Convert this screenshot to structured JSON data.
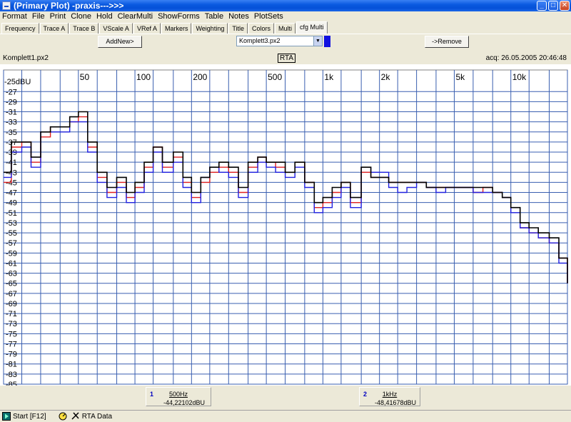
{
  "window": {
    "title": "(Primary Plot) -praxis--->>>",
    "min": "_",
    "max": "□",
    "close": "✕"
  },
  "menu": [
    "Format",
    "File",
    "Print",
    "Clone",
    "Hold",
    "ClearMulti",
    "ShowForms",
    "Table",
    "Notes",
    "PlotSets"
  ],
  "tabs": [
    "Frequency",
    "Trace A",
    "Trace B",
    "VScale A",
    "VRef A",
    "Markers",
    "Weighting",
    "Title",
    "Colors",
    "Multi",
    "cfg Multi"
  ],
  "active_tab": 10,
  "controls": {
    "add_label": "AddNew>",
    "remove_label": "->Remove",
    "selected_file": "Komplett3.px2",
    "swatch_color": "#1010e0"
  },
  "plot_info": {
    "file": "Komplett1.px2",
    "mode": "RTA",
    "acq": "acq: 26.05.2005 20:46:48"
  },
  "chart_data": {
    "type": "line",
    "x_scale": "log",
    "xlim": [
      20,
      20000
    ],
    "ylim": [
      -85,
      -23
    ],
    "y_unit_label": "-25dBU",
    "y_ticks": [
      -27,
      -29,
      -31,
      -33,
      -35,
      -37,
      -39,
      -41,
      -43,
      -45,
      -47,
      -49,
      -51,
      -53,
      -55,
      -57,
      -59,
      -61,
      -63,
      -65,
      -67,
      -69,
      -71,
      -73,
      -75,
      -77,
      -79,
      -81,
      -83,
      -85
    ],
    "x_labels": [
      {
        "f": 50,
        "label": "50"
      },
      {
        "f": 100,
        "label": "100"
      },
      {
        "f": 200,
        "label": "200"
      },
      {
        "f": 500,
        "label": "500"
      },
      {
        "f": 1000,
        "label": "1k"
      },
      {
        "f": 2000,
        "label": "2k"
      },
      {
        "f": 5000,
        "label": "5k"
      },
      {
        "f": 10000,
        "label": "10k"
      }
    ],
    "x_grid": [
      20,
      25,
      31.5,
      40,
      50,
      63,
      80,
      100,
      125,
      160,
      200,
      250,
      315,
      400,
      500,
      630,
      800,
      1000,
      1250,
      1600,
      2000,
      2500,
      3150,
      4000,
      5000,
      6300,
      8000,
      10000,
      12500,
      16000,
      20000
    ],
    "grid": true,
    "series": [
      {
        "color": "#e02020",
        "x": [
          20,
          22,
          25,
          28,
          31.5,
          35.5,
          40,
          45,
          50,
          56,
          63,
          71,
          80,
          90,
          100,
          112,
          125,
          140,
          160,
          180,
          200,
          224,
          250,
          280,
          315,
          355,
          400,
          450,
          500,
          560,
          630,
          710,
          800,
          900,
          1000,
          1120,
          1250,
          1400,
          1600,
          1800,
          2000,
          2240,
          2500,
          2800,
          3150,
          3550,
          4000,
          4500,
          5000,
          5600,
          6300,
          7100,
          8000,
          9000,
          10000,
          11200,
          12500,
          14000,
          16000,
          18000,
          20000
        ],
        "y": [
          -45,
          -38,
          -37,
          -41,
          -36,
          -34,
          -34,
          -33,
          -32,
          -38,
          -44,
          -47,
          -45,
          -48,
          -46,
          -42,
          -38,
          -42,
          -40,
          -45,
          -48,
          -45,
          -43,
          -42,
          -43,
          -47,
          -42,
          -40,
          -41,
          -42,
          -43,
          -41,
          -45,
          -50,
          -49,
          -47,
          -45,
          -49,
          -43,
          -44,
          -44,
          -45,
          -45,
          -45,
          -45,
          -46,
          -46,
          -46,
          -46,
          -46,
          -47,
          -46,
          -47,
          -48,
          -50,
          -54,
          -55,
          -56,
          -57,
          -60,
          -65
        ]
      },
      {
        "color": "#2020e0",
        "x": [
          20,
          22,
          25,
          28,
          31.5,
          35.5,
          40,
          45,
          50,
          56,
          63,
          71,
          80,
          90,
          100,
          112,
          125,
          140,
          160,
          180,
          200,
          224,
          250,
          280,
          315,
          355,
          400,
          450,
          500,
          560,
          630,
          710,
          800,
          900,
          1000,
          1120,
          1250,
          1400,
          1600,
          1800,
          2000,
          2240,
          2500,
          2800,
          3150,
          3550,
          4000,
          4500,
          5000,
          5600,
          6300,
          7100,
          8000,
          9000,
          10000,
          11200,
          12500,
          14000,
          16000,
          18000,
          20000
        ],
        "y": [
          -44,
          -39,
          -38,
          -42,
          -35,
          -35,
          -35,
          -33,
          -33,
          -39,
          -45,
          -48,
          -46,
          -49,
          -47,
          -43,
          -39,
          -43,
          -41,
          -46,
          -49,
          -44,
          -42,
          -43,
          -44,
          -48,
          -43,
          -41,
          -42,
          -43,
          -44,
          -42,
          -46,
          -51,
          -50,
          -48,
          -46,
          -50,
          -42,
          -43,
          -43,
          -46,
          -47,
          -46,
          -45,
          -46,
          -47,
          -46,
          -46,
          -46,
          -47,
          -47,
          -47,
          -48,
          -51,
          -54,
          -55,
          -56,
          -57,
          -61,
          -65
        ]
      },
      {
        "color": "#000000",
        "x": [
          20,
          22,
          25,
          28,
          31.5,
          35.5,
          40,
          45,
          50,
          56,
          63,
          71,
          80,
          90,
          100,
          112,
          125,
          140,
          160,
          180,
          200,
          224,
          250,
          280,
          315,
          355,
          400,
          450,
          500,
          560,
          630,
          710,
          800,
          900,
          1000,
          1120,
          1250,
          1400,
          1600,
          1800,
          2000,
          2240,
          2500,
          2800,
          3150,
          3550,
          4000,
          4500,
          5000,
          5600,
          6300,
          7100,
          8000,
          9000,
          10000,
          11200,
          12500,
          14000,
          16000,
          18000,
          20000
        ],
        "y": [
          -43,
          -37,
          -37,
          -40,
          -35,
          -34,
          -34,
          -32,
          -31,
          -37,
          -43,
          -46,
          -44,
          -47,
          -45,
          -41,
          -38,
          -41,
          -39,
          -44,
          -47,
          -44,
          -42,
          -41,
          -42,
          -46,
          -41,
          -40,
          -41,
          -41,
          -43,
          -41,
          -45,
          -49,
          -48,
          -46,
          -45,
          -48,
          -42,
          -44,
          -44,
          -45,
          -45,
          -45,
          -45,
          -46,
          -46,
          -46,
          -46,
          -46,
          -46,
          -46,
          -47,
          -48,
          -50,
          -53,
          -54,
          -55,
          -56,
          -60,
          -65
        ]
      }
    ]
  },
  "cursors": [
    {
      "index": "1",
      "freq": "500Hz",
      "value": "-44,22102dBU"
    },
    {
      "index": "2",
      "freq": "1kHz",
      "value": "-48,41678dBU"
    }
  ],
  "status": {
    "start": "Start [F12]",
    "label": "RTA Data"
  }
}
